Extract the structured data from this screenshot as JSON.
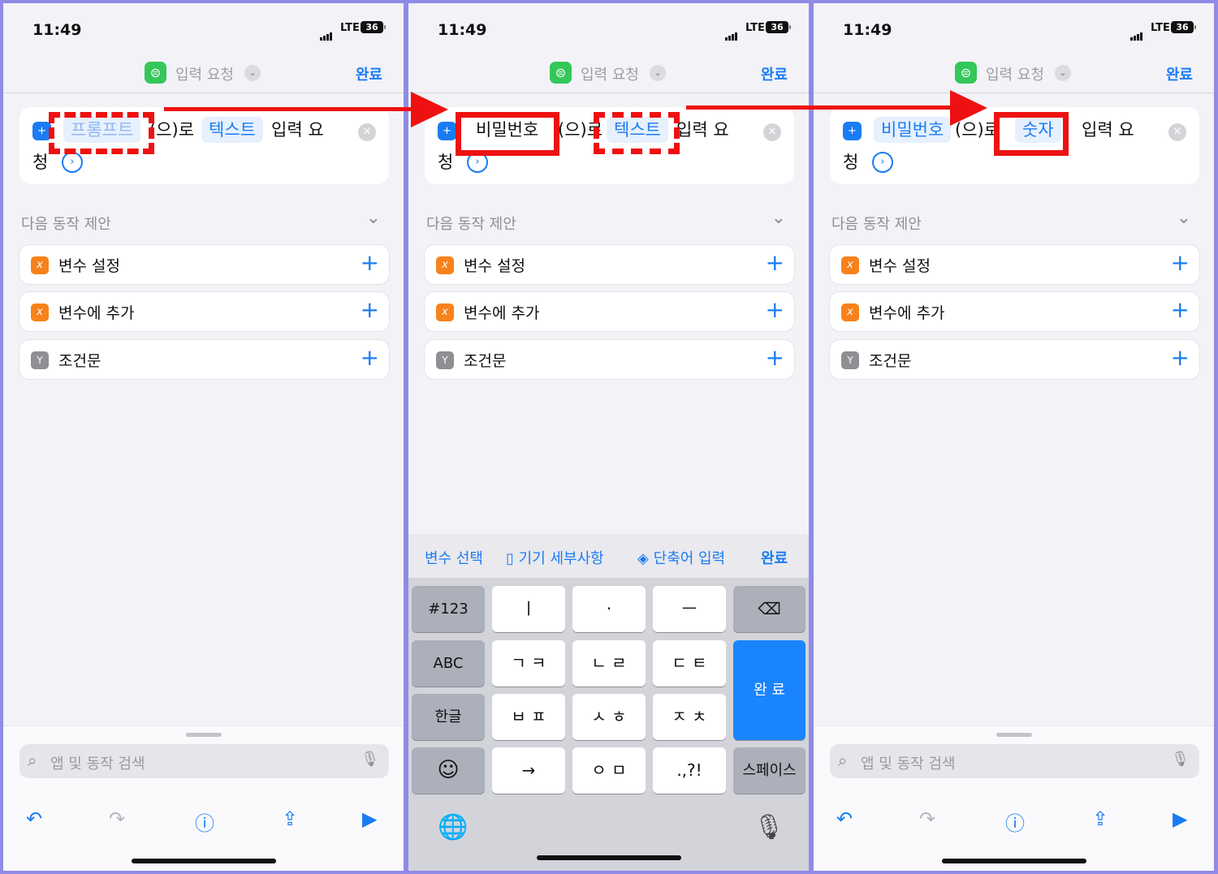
{
  "status": {
    "time": "11:49",
    "network": "LTE",
    "battery": "36"
  },
  "nav": {
    "title": "입력 요청",
    "done": "완료"
  },
  "card": {
    "field": "(으)로",
    "request_1": "입력 요",
    "request_2": "청"
  },
  "panels": [
    {
      "prompt": "프롬프트",
      "type": "텍스트"
    },
    {
      "prompt": "비밀번호",
      "type": "텍스트"
    },
    {
      "prompt": "비밀번호",
      "type": "숫자"
    }
  ],
  "suggestions": {
    "title": "다음 동작 제안",
    "items": [
      {
        "label": "변수 설정",
        "icon": "variable-icon"
      },
      {
        "label": "변수에 추가",
        "icon": "variable-icon"
      },
      {
        "label": "조건문",
        "icon": "branch-icon"
      }
    ]
  },
  "search": {
    "placeholder": "앱 및 동작 검색"
  },
  "accessory": {
    "select_variable": "변수 선택",
    "device_details": "기기 세부사항",
    "shortcut_input": "단축어 입력",
    "done": "완료"
  },
  "keyboard": {
    "num": "#123",
    "abc": "ABC",
    "hangul": "한글",
    "emoji": "☺",
    "row1": [
      "ㅣ",
      "·",
      "ㅡ"
    ],
    "row2": [
      "ㄱ ㅋ",
      "ㄴ ㄹ",
      "ㄷ ㅌ"
    ],
    "row3": [
      "ㅂ ㅍ",
      "ㅅ ㅎ",
      "ㅈ ㅊ"
    ],
    "row4": [
      "→",
      "ㅇ ㅁ",
      ".,?!"
    ],
    "done": "완 료",
    "space": "스페이스",
    "backspace": "⌫",
    "globe": "🌐",
    "mic": "🎙"
  },
  "colors": {
    "accent": "#1a7cf4",
    "annotation": "#ee1111",
    "frame": "#8f8be6"
  }
}
